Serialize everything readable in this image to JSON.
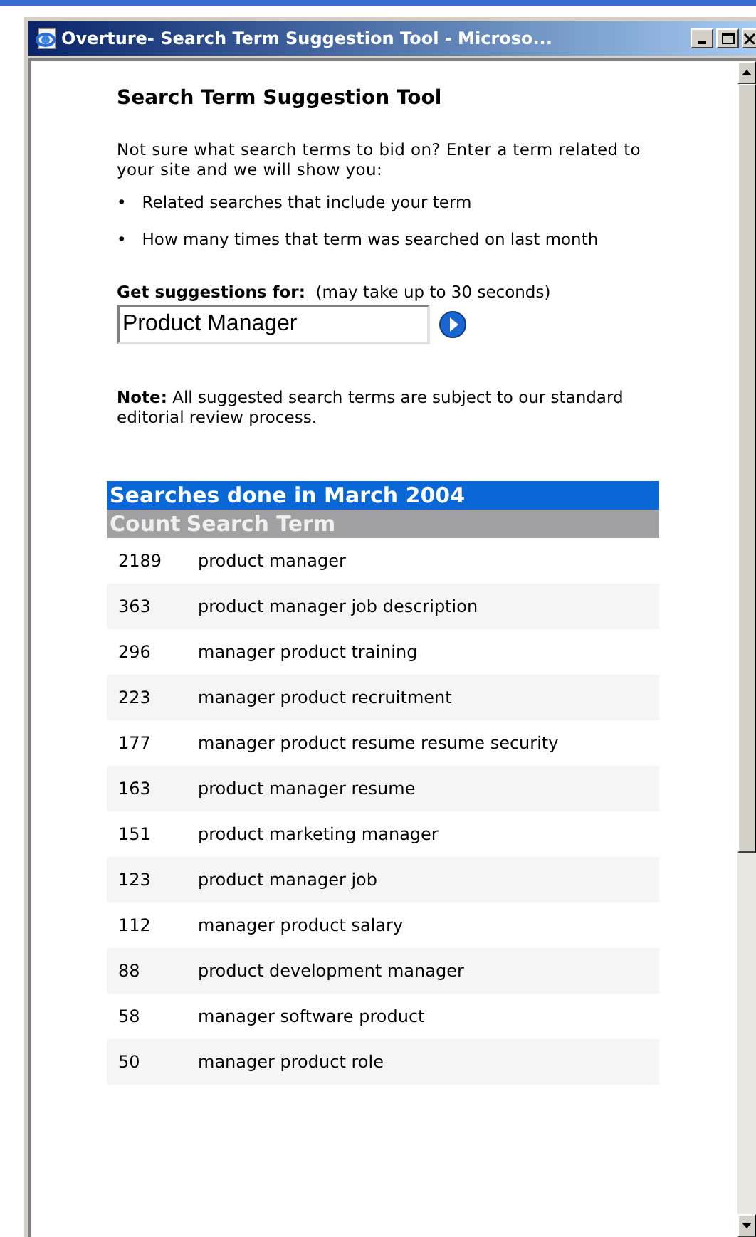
{
  "window": {
    "title": "Overture- Search Term Suggestion Tool - Microso..."
  },
  "heading": "Search Term Suggestion Tool",
  "intro": "Not sure what search terms to bid on? Enter a term related to your site and we will show you:",
  "bullets": [
    {
      "marker": "•",
      "text": "Related searches that include your term"
    },
    {
      "marker": "•",
      "text": "How many times that term was searched on last month"
    }
  ],
  "query": {
    "label": "**Get suggestions for:**  (may take up to 30 seconds)",
    "value": "Product Manager"
  },
  "note": "**Note:** All suggested search terms are subject to our standard editorial review process.",
  "table": {
    "title": "Searches done in March 2004",
    "columns": [
      "Count",
      "Search Term"
    ],
    "rows": [
      [
        "2189",
        "product manager"
      ],
      [
        "363",
        "product manager job description"
      ],
      [
        "296",
        "manager product training"
      ],
      [
        "223",
        "manager product recruitment"
      ],
      [
        "177",
        "manager product resume resume security"
      ],
      [
        "163",
        "product manager resume"
      ],
      [
        "151",
        "product marketing manager"
      ],
      [
        "123",
        "product manager job"
      ],
      [
        "112",
        "manager product salary"
      ],
      [
        "88",
        "product development manager"
      ],
      [
        "58",
        "manager software product"
      ],
      [
        "50",
        "manager product role"
      ]
    ]
  }
}
